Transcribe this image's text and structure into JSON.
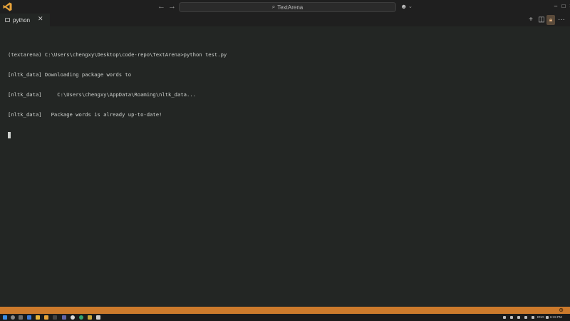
{
  "titlebar": {
    "search_text": "TextArena",
    "back_icon": "arrow-left-icon",
    "forward_icon": "arrow-right-icon",
    "copilot_icon": "copilot-icon",
    "window_controls": [
      "minimize-icon",
      "maximize-icon",
      "close-icon"
    ]
  },
  "tab": {
    "label": "python",
    "close_glyph": "✕",
    "icon": "terminal-icon"
  },
  "toolbar_icons": [
    "plus-icon",
    "split-editor-icon",
    "lock-icon",
    "more-icon"
  ],
  "terminal": {
    "lines": [
      "(textarena) C:\\Users\\chengxy\\Desktop\\code-repo\\TextArena>python test.py",
      "[nltk_data] Downloading package words to",
      "[nltk_data]     C:\\Users\\chengxy\\AppData\\Roaming\\nltk_data...",
      "[nltk_data]   Package words is already up-to-date!"
    ]
  },
  "statusbar": {
    "accent_color": "#cc7a2c",
    "zoom_icon": "zoom-icon"
  },
  "taskbar": {
    "lang": "ENG",
    "time": "6:19 PM"
  }
}
